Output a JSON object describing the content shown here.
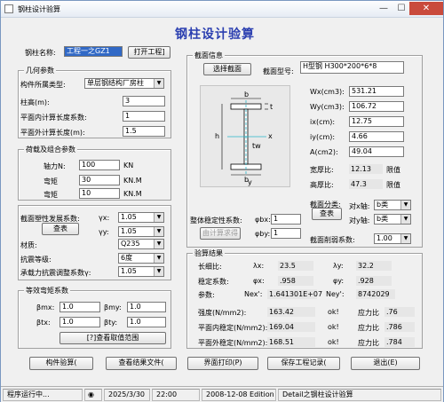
{
  "window": {
    "title": "钢柱设计验算",
    "min_label": "—",
    "max_label": "☐",
    "close_label": "✕"
  },
  "heading": "钢柱设计验算",
  "name_row": {
    "label": "钢柱名称:",
    "value": "工程一之GZ1",
    "open_button": "打开工程]"
  },
  "geometry": {
    "title": "几何参数",
    "structure_type": {
      "label": "构件所属类型:",
      "value": "单层钢结构厂房柱"
    },
    "height": {
      "label": "柱高(m):",
      "value": "3"
    },
    "in_plane": {
      "label": "平面内计算长度系数:",
      "value": "1"
    },
    "out_plane": {
      "label": "平面外计算长度(m):",
      "value": "1.5"
    }
  },
  "loads": {
    "title": "荷载及组合参数",
    "axial": {
      "label": "轴力N:",
      "value": "100",
      "unit": "KN"
    },
    "moment1": {
      "label": "弯矩",
      "value": "30",
      "unit": "KN.M"
    },
    "moment2": {
      "label": "弯矩",
      "value": "10",
      "unit": "KN.M"
    }
  },
  "plastic": {
    "label": "截面塑性发展系数:",
    "gx_label": "γx:",
    "gx_value": "1.05",
    "gy_label": "γy:",
    "gy_value": "1.05",
    "lookup_button": "查表",
    "material_label": "材质:",
    "material_value": "Q235",
    "seismic_label": "抗震等级:",
    "seismic_value": "6度",
    "adjust_label": "承载力抗震调整系数γ:",
    "adjust_value": "1.05"
  },
  "equiv": {
    "title": "等效弯矩系数",
    "bmx_label": "βmx:",
    "bmx_value": "1.0",
    "bmy_label": "βmy:",
    "bmy_value": "1.0",
    "btx_label": "βtx:",
    "btx_value": "1.0",
    "bty_label": "βty:",
    "bty_value": "1.0",
    "range_button": "[?]查看取值范围"
  },
  "section": {
    "title": "截面信息",
    "select_button": "选择截面",
    "model_label": "截面型号:",
    "model_value": "H型钢 H300*200*6*8",
    "props": [
      {
        "label": "Wx(cm3):",
        "value": "531.21"
      },
      {
        "label": "Wy(cm3):",
        "value": "106.72"
      },
      {
        "label": "ix(cm):",
        "value": "12.75"
      },
      {
        "label": "iy(cm):",
        "value": "4.66"
      },
      {
        "label": "A(cm2):",
        "value": "49.04"
      }
    ],
    "width_ratio": {
      "label": "宽厚比:",
      "value": "12.13",
      "limit": "限值"
    },
    "height_ratio": {
      "label": "高厚比:",
      "value": "47.3",
      "limit": "限值"
    },
    "classify_label": "截面分类:",
    "classify_button": "查表",
    "x_axis_label": "对x轴:",
    "x_axis_value": "b类",
    "y_axis_label": "对y轴:",
    "y_axis_value": "b类",
    "overall_label": "整体稳定性系数:",
    "phib_label": "φbx:",
    "phib_value": "1",
    "phiby_label": "φby:",
    "phiby_value": "1",
    "calc_button": "由计算求得",
    "reduce_label": "截面削弱系数:",
    "reduce_value": "1.00",
    "diagram_labels": {
      "b": "b",
      "h": "h",
      "tw": "tw",
      "t": "t",
      "x": "x",
      "y": "y"
    }
  },
  "results": {
    "title": "验算结果",
    "slender_label": "长细比:",
    "lx_label": "λx:",
    "lx_value": "23.5",
    "ly_label": "λy:",
    "ly_value": "32.2",
    "stable_label": "稳定系数:",
    "phix_label": "φx:",
    "phix_value": ".958",
    "phiy_label": "φy:",
    "phiy_value": ".928",
    "param_label": "参数:",
    "nex_label": "Nex':",
    "nex_value": "1.641301E+07",
    "ney_label": "Ney':",
    "ney_value": "8742029",
    "rows": [
      {
        "label": "强度(N/mm2):",
        "value": "163.42",
        "status": "ok!",
        "ratio_label": "应力比",
        "ratio": ".76"
      },
      {
        "label": "平面内稳定(N/mm2):",
        "value": "169.04",
        "status": "ok!",
        "ratio_label": "应力比",
        "ratio": ".786"
      },
      {
        "label": "平面外稳定(N/mm2):",
        "value": "168.51",
        "status": "ok!",
        "ratio_label": "应力比",
        "ratio": ".784"
      }
    ]
  },
  "actions": [
    "构件验算(",
    "查看结果文件(",
    "界面打印(P)",
    "保存工程记录(",
    "退出(E)"
  ],
  "statusbar": {
    "running": "程序运行中...",
    "date": "2025/3/30",
    "time": "22:00",
    "edition": "2008-12-08 Edition",
    "app": "Detail之钢柱设计验算"
  }
}
